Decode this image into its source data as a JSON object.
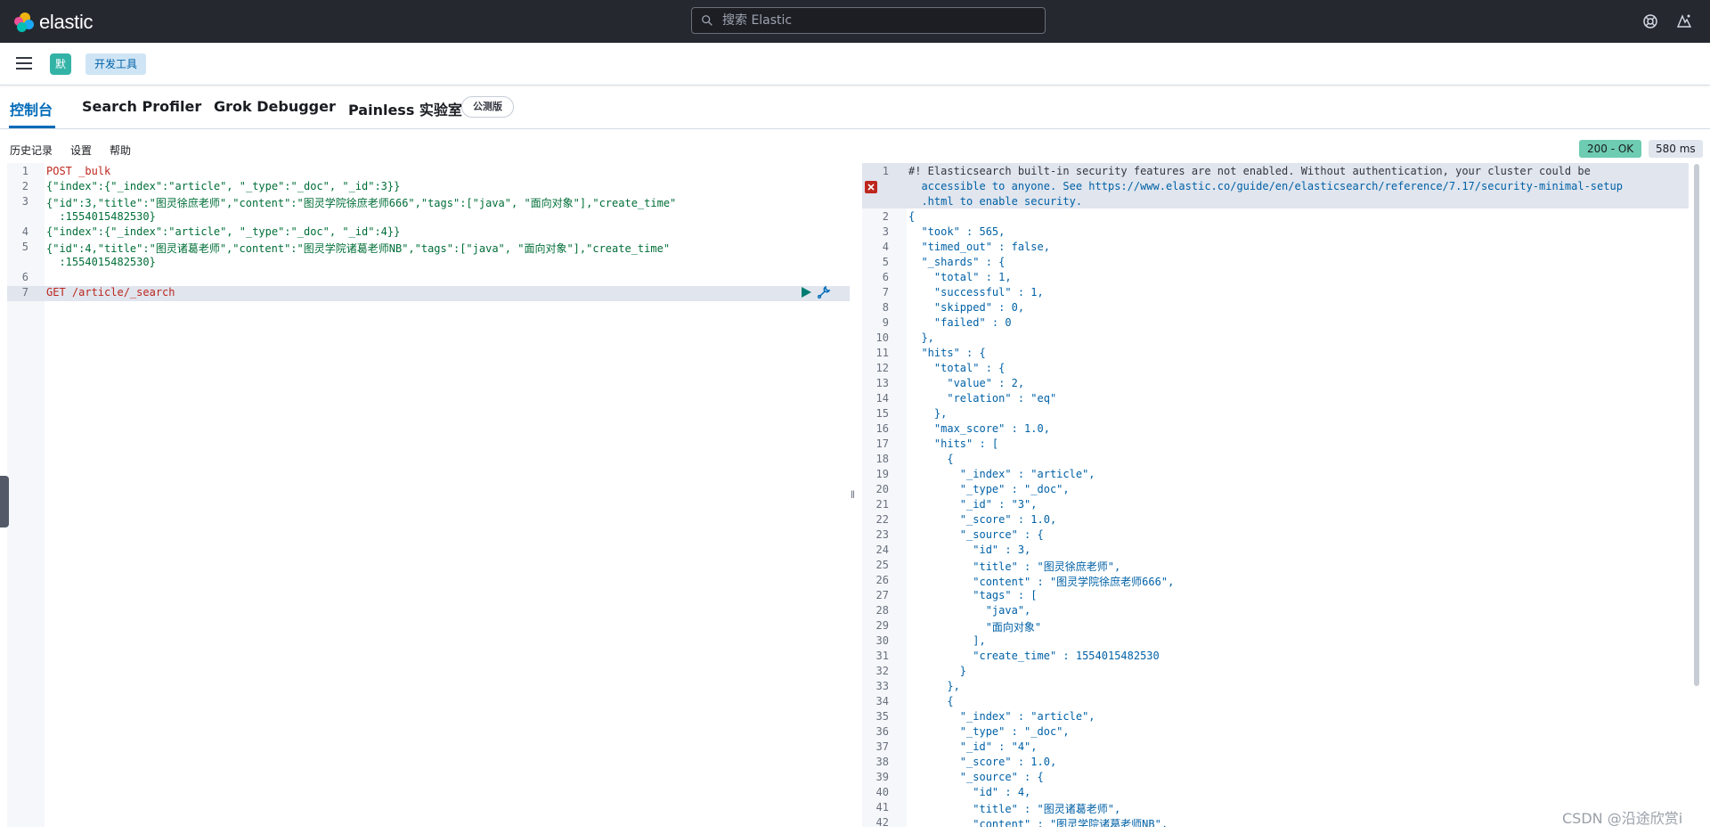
{
  "header": {
    "brand": "elastic",
    "search_placeholder": "搜索 Elastic"
  },
  "nav": {
    "space_initial": "默",
    "breadcrumb": "开发工具"
  },
  "tabs": [
    {
      "label": "控制台"
    },
    {
      "label": "Search Profiler"
    },
    {
      "label": "Grok Debugger"
    },
    {
      "label": "Painless 实验室"
    }
  ],
  "beta_badge": "公测版",
  "toolbar": {
    "history": "历史记录",
    "settings": "设置",
    "help": "帮助"
  },
  "status": {
    "code": "200 - OK",
    "time": "580 ms"
  },
  "request_lines": [
    {
      "n": "1",
      "text": "POST _bulk"
    },
    {
      "n": "2",
      "text": "{\"index\":{\"_index\":\"article\", \"_type\":\"_doc\", \"_id\":3}}"
    },
    {
      "n": "3",
      "text": "{\"id\":3,\"title\":\"图灵徐庶老师\",\"content\":\"图灵学院徐庶老师666\",\"tags\":[\"java\", \"面向对象\"],\"create_time\""
    },
    {
      "n": "",
      "text": "  :1554015482530}"
    },
    {
      "n": "4",
      "text": "{\"index\":{\"_index\":\"article\", \"_type\":\"_doc\", \"_id\":4}}"
    },
    {
      "n": "5",
      "text": "{\"id\":4,\"title\":\"图灵诸葛老师\",\"content\":\"图灵学院诸葛老师NB\",\"tags\":[\"java\", \"面向对象\"],\"create_time\""
    },
    {
      "n": "",
      "text": "  :1554015482530}"
    },
    {
      "n": "6",
      "text": ""
    },
    {
      "n": "7",
      "text": "GET /article/_search"
    }
  ],
  "response_lines": [
    {
      "n": "1",
      "text": "#! Elasticsearch built-in security features are not enabled. Without authentication, your cluster could be"
    },
    {
      "n": "",
      "text": "  accessible to anyone. See https://www.elastic.co/guide/en/elasticsearch/reference/7.17/security-minimal-setup"
    },
    {
      "n": "",
      "text": "  .html to enable security."
    },
    {
      "n": "2",
      "text": "{"
    },
    {
      "n": "3",
      "text": "  \"took\" : 565,"
    },
    {
      "n": "4",
      "text": "  \"timed_out\" : false,"
    },
    {
      "n": "5",
      "text": "  \"_shards\" : {"
    },
    {
      "n": "6",
      "text": "    \"total\" : 1,"
    },
    {
      "n": "7",
      "text": "    \"successful\" : 1,"
    },
    {
      "n": "8",
      "text": "    \"skipped\" : 0,"
    },
    {
      "n": "9",
      "text": "    \"failed\" : 0"
    },
    {
      "n": "10",
      "text": "  },"
    },
    {
      "n": "11",
      "text": "  \"hits\" : {"
    },
    {
      "n": "12",
      "text": "    \"total\" : {"
    },
    {
      "n": "13",
      "text": "      \"value\" : 2,"
    },
    {
      "n": "14",
      "text": "      \"relation\" : \"eq\""
    },
    {
      "n": "15",
      "text": "    },"
    },
    {
      "n": "16",
      "text": "    \"max_score\" : 1.0,"
    },
    {
      "n": "17",
      "text": "    \"hits\" : ["
    },
    {
      "n": "18",
      "text": "      {"
    },
    {
      "n": "19",
      "text": "        \"_index\" : \"article\","
    },
    {
      "n": "20",
      "text": "        \"_type\" : \"_doc\","
    },
    {
      "n": "21",
      "text": "        \"_id\" : \"3\","
    },
    {
      "n": "22",
      "text": "        \"_score\" : 1.0,"
    },
    {
      "n": "23",
      "text": "        \"_source\" : {"
    },
    {
      "n": "24",
      "text": "          \"id\" : 3,"
    },
    {
      "n": "25",
      "text": "          \"title\" : \"图灵徐庶老师\","
    },
    {
      "n": "26",
      "text": "          \"content\" : \"图灵学院徐庶老师666\","
    },
    {
      "n": "27",
      "text": "          \"tags\" : ["
    },
    {
      "n": "28",
      "text": "            \"java\","
    },
    {
      "n": "29",
      "text": "            \"面向对象\""
    },
    {
      "n": "30",
      "text": "          ],"
    },
    {
      "n": "31",
      "text": "          \"create_time\" : 1554015482530"
    },
    {
      "n": "32",
      "text": "        }"
    },
    {
      "n": "33",
      "text": "      },"
    },
    {
      "n": "34",
      "text": "      {"
    },
    {
      "n": "35",
      "text": "        \"_index\" : \"article\","
    },
    {
      "n": "36",
      "text": "        \"_type\" : \"_doc\","
    },
    {
      "n": "37",
      "text": "        \"_id\" : \"4\","
    },
    {
      "n": "38",
      "text": "        \"_score\" : 1.0,"
    },
    {
      "n": "39",
      "text": "        \"_source\" : {"
    },
    {
      "n": "40",
      "text": "          \"id\" : 4,"
    },
    {
      "n": "41",
      "text": "          \"title\" : \"图灵诸葛老师\","
    },
    {
      "n": "42",
      "text": "          \"content\" : \"图灵学院诸葛老师NB\","
    }
  ],
  "watermark": "CSDN @沿途欣赏i"
}
